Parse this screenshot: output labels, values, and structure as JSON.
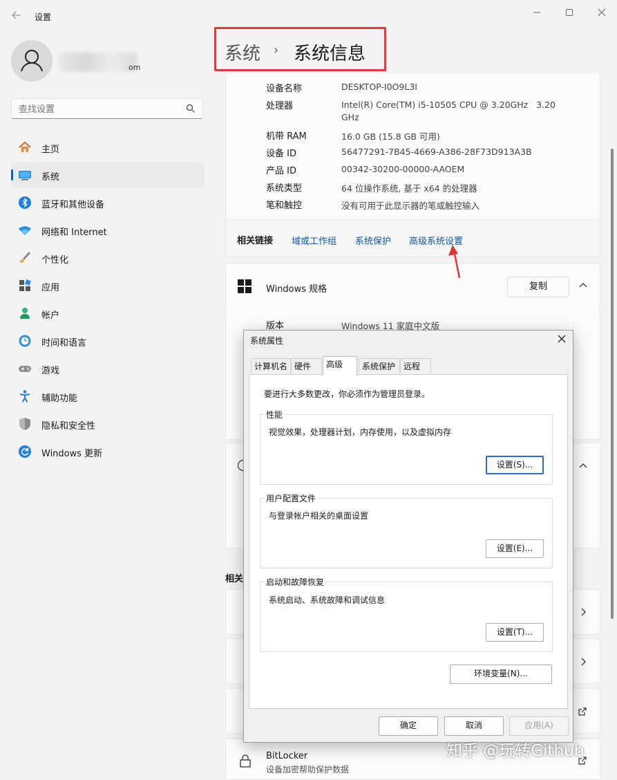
{
  "app": {
    "title": "设置"
  },
  "user": {
    "email_suffix": "om"
  },
  "search": {
    "placeholder": "查找设置"
  },
  "sidebar": {
    "items": [
      {
        "label": "主页",
        "icon": "home-icon"
      },
      {
        "label": "系统",
        "icon": "system-icon",
        "active": true
      },
      {
        "label": "蓝牙和其他设备",
        "icon": "bluetooth-icon"
      },
      {
        "label": "网络和 Internet",
        "icon": "wifi-icon"
      },
      {
        "label": "个性化",
        "icon": "brush-icon"
      },
      {
        "label": "应用",
        "icon": "apps-icon"
      },
      {
        "label": "帐户",
        "icon": "person-icon"
      },
      {
        "label": "时间和语言",
        "icon": "clock-globe-icon"
      },
      {
        "label": "游戏",
        "icon": "gamepad-icon"
      },
      {
        "label": "辅助功能",
        "icon": "accessibility-icon"
      },
      {
        "label": "隐私和安全性",
        "icon": "shield-icon"
      },
      {
        "label": "Windows 更新",
        "icon": "update-icon"
      }
    ]
  },
  "header": {
    "parent": "系统",
    "separator": "›",
    "current": "系统信息"
  },
  "device_specs": [
    {
      "key": "设备名称",
      "value": "DESKTOP-I0O9L3I"
    },
    {
      "key": "处理器",
      "value": "Intel(R) Core(TM) i5-10505 CPU @ 3.20GHz   3.20",
      "value2": "GHz"
    },
    {
      "key": "机带 RAM",
      "value": "16.0 GB (15.8 GB 可用)"
    },
    {
      "key": "设备 ID",
      "value": "56477291-7B45-4669-A386-28F73D913A3B"
    },
    {
      "key": "产品 ID",
      "value": "00342-30200-00000-AAOEM"
    },
    {
      "key": "系统类型",
      "value": "64 位操作系统, 基于 x64 的处理器"
    },
    {
      "key": "笔和触控",
      "value": "没有可用于此显示器的笔或触控输入"
    }
  ],
  "related_links": {
    "label": "相关链接",
    "links": [
      "域或工作组",
      "系统保护",
      "高级系统设置"
    ]
  },
  "windows_spec": {
    "title": "Windows 规格",
    "copy_label": "复制",
    "version_key": "版本",
    "version_value": "Windows 11 家庭中文版"
  },
  "background_rows": {
    "related_partial": "相关",
    "bitlocker_title": "BitLocker",
    "bitlocker_desc": "设备加密帮助保护数据"
  },
  "dialog": {
    "title": "系统属性",
    "tabs": [
      "计算机名",
      "硬件",
      "高级",
      "系统保护",
      "远程"
    ],
    "selected_tab": "高级",
    "admin_note": "要进行大多数更改，你必须作为管理员登录。",
    "groups": [
      {
        "label": "性能",
        "desc": "视觉效果，处理器计划，内存使用，以及虚拟内存",
        "button": "设置(S)..."
      },
      {
        "label": "用户配置文件",
        "desc": "与登录帐户相关的桌面设置",
        "button": "设置(E)..."
      },
      {
        "label": "启动和故障恢复",
        "desc": "系统启动、系统故障和调试信息",
        "button": "设置(T)..."
      }
    ],
    "env_button": "环境变量(N)...",
    "ok": "确定",
    "cancel": "取消",
    "apply": "应用(A)"
  },
  "watermark": "知乎 @玩转Github",
  "colors": {
    "accent": "#0067c0",
    "annotation": "#e03a3a",
    "link": "#0b57a4"
  }
}
